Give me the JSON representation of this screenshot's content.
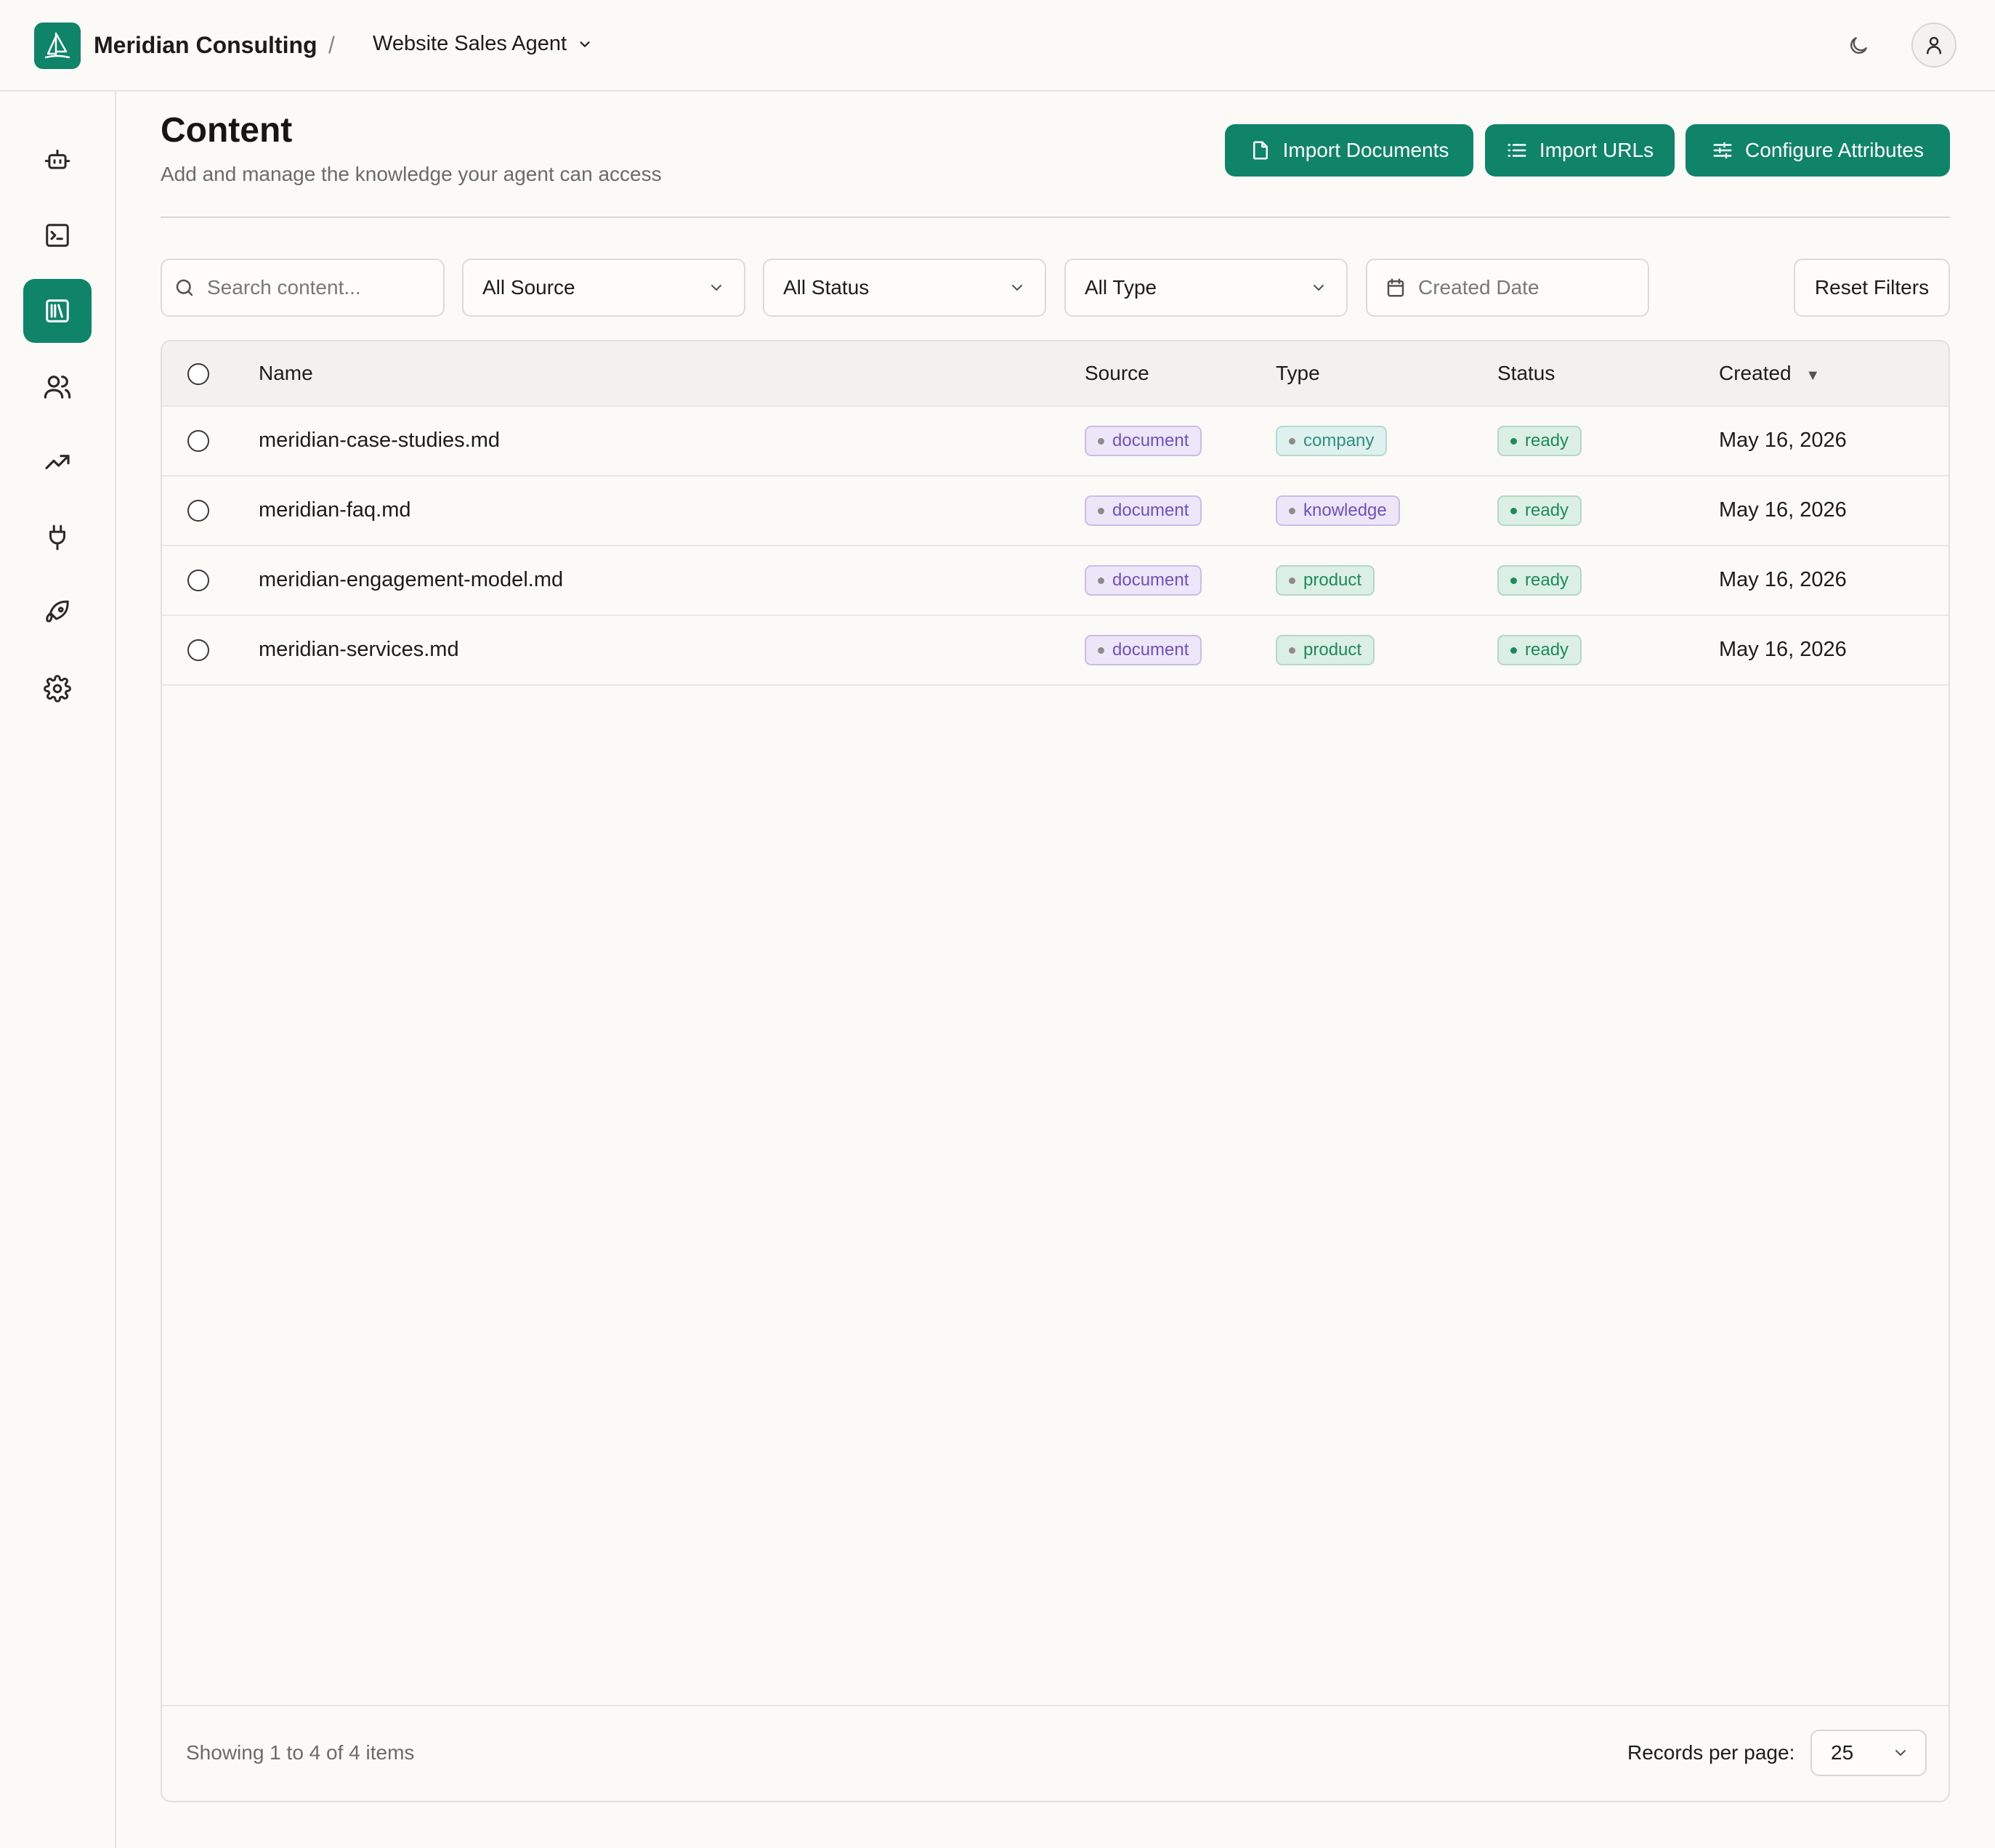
{
  "header": {
    "org_name": "Meridian Consulting",
    "separator": "/",
    "agent_name": "Website Sales Agent"
  },
  "sidebar": {
    "items": [
      {
        "icon": "bot-icon",
        "active": false
      },
      {
        "icon": "terminal-icon",
        "active": false
      },
      {
        "icon": "library-icon",
        "active": true
      },
      {
        "icon": "users-icon",
        "active": false
      },
      {
        "icon": "trending-up-icon",
        "active": false
      },
      {
        "icon": "plug-icon",
        "active": false
      },
      {
        "icon": "rocket-icon",
        "active": false
      },
      {
        "icon": "settings-gear-icon",
        "active": false
      }
    ]
  },
  "page": {
    "title": "Content",
    "subtitle": "Add and manage the knowledge your agent can access"
  },
  "actions": {
    "import_documents": "Import Documents",
    "import_urls": "Import URLs",
    "configure_attributes": "Configure Attributes"
  },
  "filters": {
    "search_placeholder": "Search content...",
    "source": "All Source",
    "status": "All Status",
    "type": "All Type",
    "created_date": "Created Date",
    "reset": "Reset Filters"
  },
  "table": {
    "columns": {
      "name": "Name",
      "source": "Source",
      "type": "Type",
      "status": "Status",
      "created": "Created",
      "sort_indicator": "▼"
    },
    "rows": [
      {
        "name": "meridian-case-studies.md",
        "source": "document",
        "type": "company",
        "status": "ready",
        "created": "May 16, 2026"
      },
      {
        "name": "meridian-faq.md",
        "source": "document",
        "type": "knowledge",
        "status": "ready",
        "created": "May 16, 2026"
      },
      {
        "name": "meridian-engagement-model.md",
        "source": "document",
        "type": "product",
        "status": "ready",
        "created": "May 16, 2026"
      },
      {
        "name": "meridian-services.md",
        "source": "document",
        "type": "product",
        "status": "ready",
        "created": "May 16, 2026"
      }
    ]
  },
  "footer": {
    "showing": "Showing 1 to 4 of 4 items",
    "records_per_page_label": "Records per page:",
    "records_per_page_value": "25"
  },
  "colors": {
    "brand": "#108469",
    "background": "#fcfaf6",
    "badge_document": "#7050bf",
    "badge_company": "#2f8f82",
    "badge_knowledge": "#7050bf",
    "badge_product": "#1f8a58",
    "badge_ready": "#1f8a58"
  }
}
